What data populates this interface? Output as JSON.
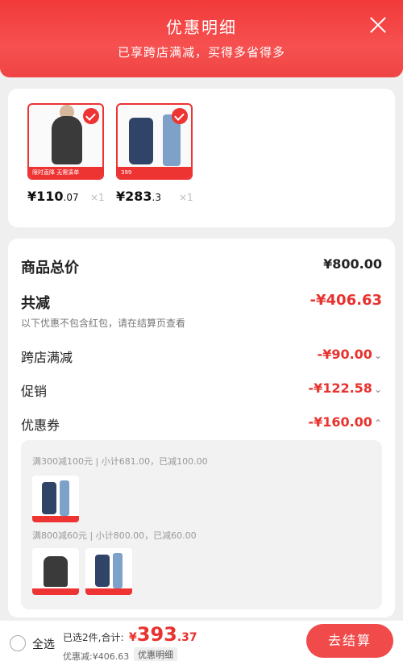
{
  "header": {
    "title": "优惠明细",
    "subtitle": "已享跨店满减，买得多省得多"
  },
  "products": [
    {
      "price_int": "¥110",
      "price_dec": ".07",
      "qty": "×1",
      "banner": "限时直降 无需凑单"
    },
    {
      "price_int": "¥283",
      "price_dec": ".3",
      "qty": "×1",
      "banner": "399"
    }
  ],
  "summary": {
    "total_label": "商品总价",
    "total_value": "¥800.00",
    "reduce_label": "共减",
    "reduce_value": "-¥406.63",
    "note": "以下优惠不包含红包，请在结算页查看",
    "items": [
      {
        "label": "跨店满减",
        "value": "-¥90.00"
      },
      {
        "label": "促销",
        "value": "-¥122.58"
      },
      {
        "label": "优惠券",
        "value": "-¥160.00"
      }
    ],
    "coupons": [
      {
        "text": "满300减100元 | 小计681.00，已减100.00"
      },
      {
        "text": "满800减60元 | 小计800.00，已减60.00"
      }
    ]
  },
  "bottom": {
    "select_all": "全选",
    "selected_total": "已选2件,合计:",
    "total_cur": "¥",
    "total_int": "393",
    "total_dec": ".37",
    "reduced": "优惠减:¥406.63",
    "detail_tag": "优惠明细",
    "checkout": "去结算"
  },
  "colors": {
    "accent": "#e8322e",
    "header": "#f23a3a"
  }
}
